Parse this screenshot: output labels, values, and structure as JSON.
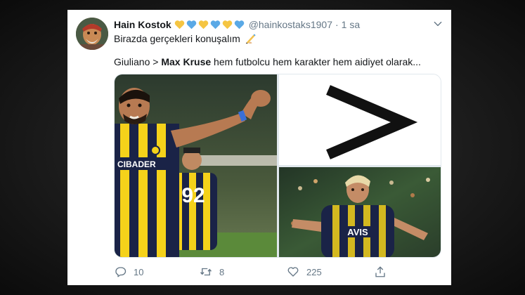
{
  "tweet": {
    "display_name": "Hain Kostok",
    "hearts": [
      "#f5c542",
      "#5aa9e6",
      "#f5c542",
      "#5aa9e6",
      "#f5c542",
      "#5aa9e6"
    ],
    "handle": "@hainkostaks1907",
    "separator": "·",
    "time": "1 sa",
    "line1": "Birazda gerçekleri konuşalım",
    "line1_emoji_icon": "writing-hand-icon",
    "line2_prefix": "Giuliano > ",
    "line2_bold": "Max Kruse",
    "line2_suffix": " hem futbolcu hem karakter hem aidiyet olarak..."
  },
  "media": {
    "left_photo": {
      "jersey_sponsor": "CIBADER",
      "jersey_number": "92"
    },
    "right_top": {
      "symbol": ">"
    },
    "right_bottom": {
      "jersey_sponsor": "AVIS"
    }
  },
  "actions": {
    "reply": {
      "icon": "reply-icon",
      "count": "10"
    },
    "retweet": {
      "icon": "retweet-icon",
      "count": "8"
    },
    "like": {
      "icon": "heart-icon",
      "count": "225"
    },
    "share": {
      "icon": "share-icon",
      "count": ""
    }
  },
  "colors": {
    "name": "#14171a",
    "secondary": "#657786",
    "yellow": "#f5c542",
    "blue": "#5aa9e6",
    "navy": "#1a2347"
  }
}
